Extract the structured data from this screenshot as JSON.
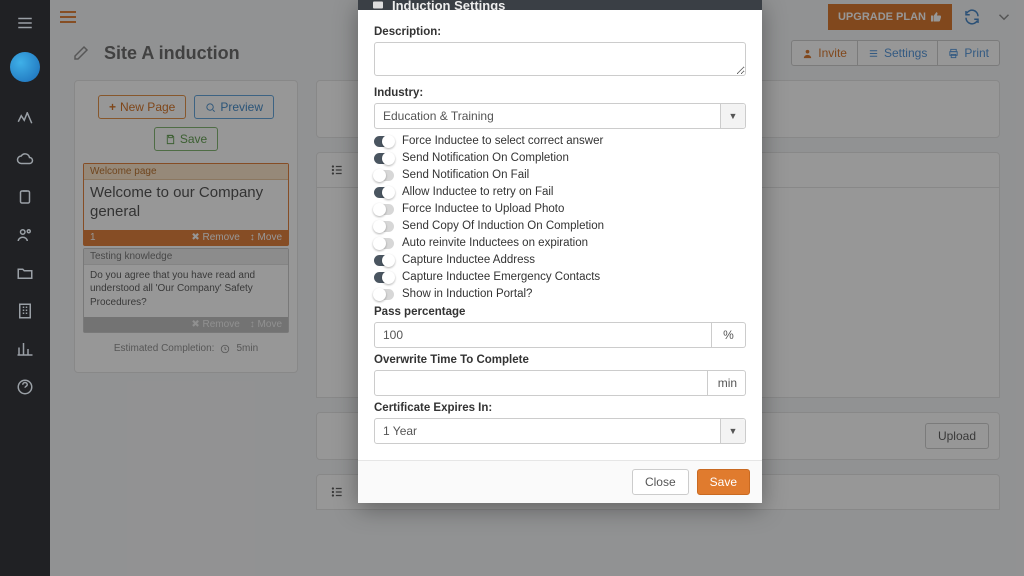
{
  "topbar": {
    "upgrade_label": "UPGRADE PLAN"
  },
  "header": {
    "title": "Site A induction",
    "invite": "Invite",
    "settings": "Settings",
    "print": "Print"
  },
  "left": {
    "new_page": "New Page",
    "preview": "Preview",
    "save": "Save",
    "card1_head": "Welcome page",
    "card1_title": "Welcome to our Company general",
    "card1_num": "1",
    "remove": "Remove",
    "move": "Move",
    "card2_head": "Testing knowledge",
    "card2_body": "Do you agree that you have read and understood all 'Our Company' Safety Procedures?",
    "est_label": "Estimated Completion:",
    "est_value": "5min"
  },
  "right": {
    "upload": "Upload"
  },
  "modal": {
    "title": "Induction Settings",
    "description_label": "Description:",
    "industry_label": "Industry:",
    "industry_value": "Education & Training",
    "toggles": [
      {
        "label": "Force Inductee to select correct answer",
        "on": true
      },
      {
        "label": "Send Notification On Completion",
        "on": true
      },
      {
        "label": "Send Notification On Fail",
        "on": false
      },
      {
        "label": "Allow Inductee to retry on Fail",
        "on": true
      },
      {
        "label": "Force Inductee to Upload Photo",
        "on": false
      },
      {
        "label": "Send Copy Of Induction On Completion",
        "on": false
      },
      {
        "label": "Auto reinvite Inductees on expiration",
        "on": false
      },
      {
        "label": "Capture Inductee Address",
        "on": true
      },
      {
        "label": "Capture Inductee Emergency Contacts",
        "on": true
      },
      {
        "label": "Show in Induction Portal?",
        "on": false
      }
    ],
    "pass_label": "Pass percentage",
    "pass_value": "100",
    "pass_suffix": "%",
    "overwrite_label": "Overwrite Time To Complete",
    "overwrite_suffix": "min",
    "expires_label": "Certificate Expires In:",
    "expires_value": "1 Year",
    "close": "Close",
    "save": "Save"
  }
}
